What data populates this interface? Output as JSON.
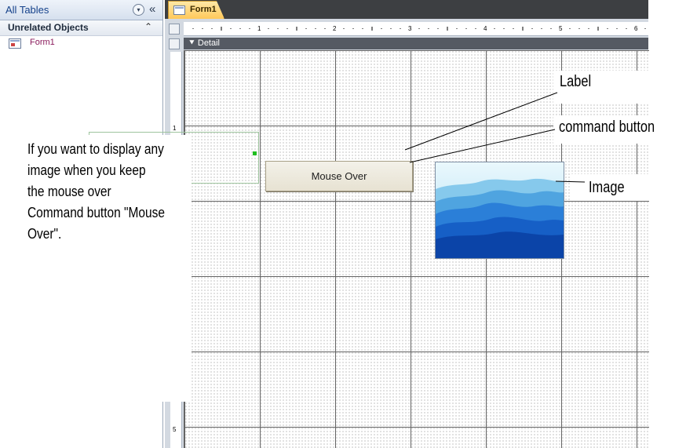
{
  "nav": {
    "title": "All Tables",
    "dropdown_glyph": "▾",
    "collapse_glyph": "«",
    "group": {
      "label": "Unrelated Objects",
      "toggle_glyph": "⌃"
    },
    "items": [
      {
        "label": "Form1",
        "icon": "form-icon"
      }
    ]
  },
  "tabs": [
    {
      "label": "Form1",
      "active": true
    }
  ],
  "design": {
    "section_label": "Detail",
    "section_glyph": "⯆",
    "ruler_numbers": [
      "1",
      "2",
      "3",
      "4",
      "5",
      "6"
    ],
    "vruler_numbers": [
      "1",
      "5"
    ]
  },
  "controls": {
    "command_button_caption": "Mouse Over"
  },
  "annotations": {
    "instruction": "If you want to display any image when you keep the mouse over Command button \"Mouse Over\".",
    "label_callout": "Label",
    "command_callout": "command button",
    "image_callout": "Image"
  },
  "colors": {
    "tab_active": "#ffc85a",
    "nav_item_text": "#8a1b5c",
    "nav_header_text": "#15428b",
    "selection_handle": "#1fbf1f"
  }
}
